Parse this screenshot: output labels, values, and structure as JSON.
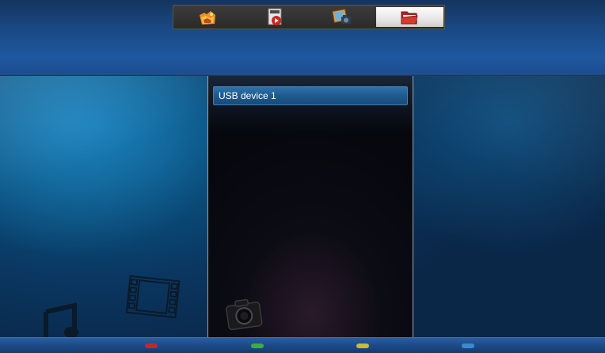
{
  "tabs": [
    {
      "id": "photo",
      "icon": "photo-tab-icon"
    },
    {
      "id": "video",
      "icon": "video-tab-icon"
    },
    {
      "id": "picture",
      "icon": "picture-tab-icon"
    },
    {
      "id": "files",
      "icon": "folder-tab-icon",
      "active": true
    }
  ],
  "file_list": {
    "items": [
      {
        "label": "USB device 1",
        "selected": true
      }
    ]
  },
  "color_buttons": [
    {
      "name": "red-button",
      "color": "#c0282a"
    },
    {
      "name": "green-button",
      "color": "#3cae3c"
    },
    {
      "name": "yellow-button",
      "color": "#c8b83c"
    },
    {
      "name": "blue-button",
      "color": "#3a8ad0"
    }
  ],
  "decorations": [
    "music-note-icon",
    "film-strip-icon",
    "camera-icon"
  ],
  "colors": {
    "header": "#1f57a0",
    "selection": "#2d72ab",
    "background": "#0a4e7c"
  }
}
